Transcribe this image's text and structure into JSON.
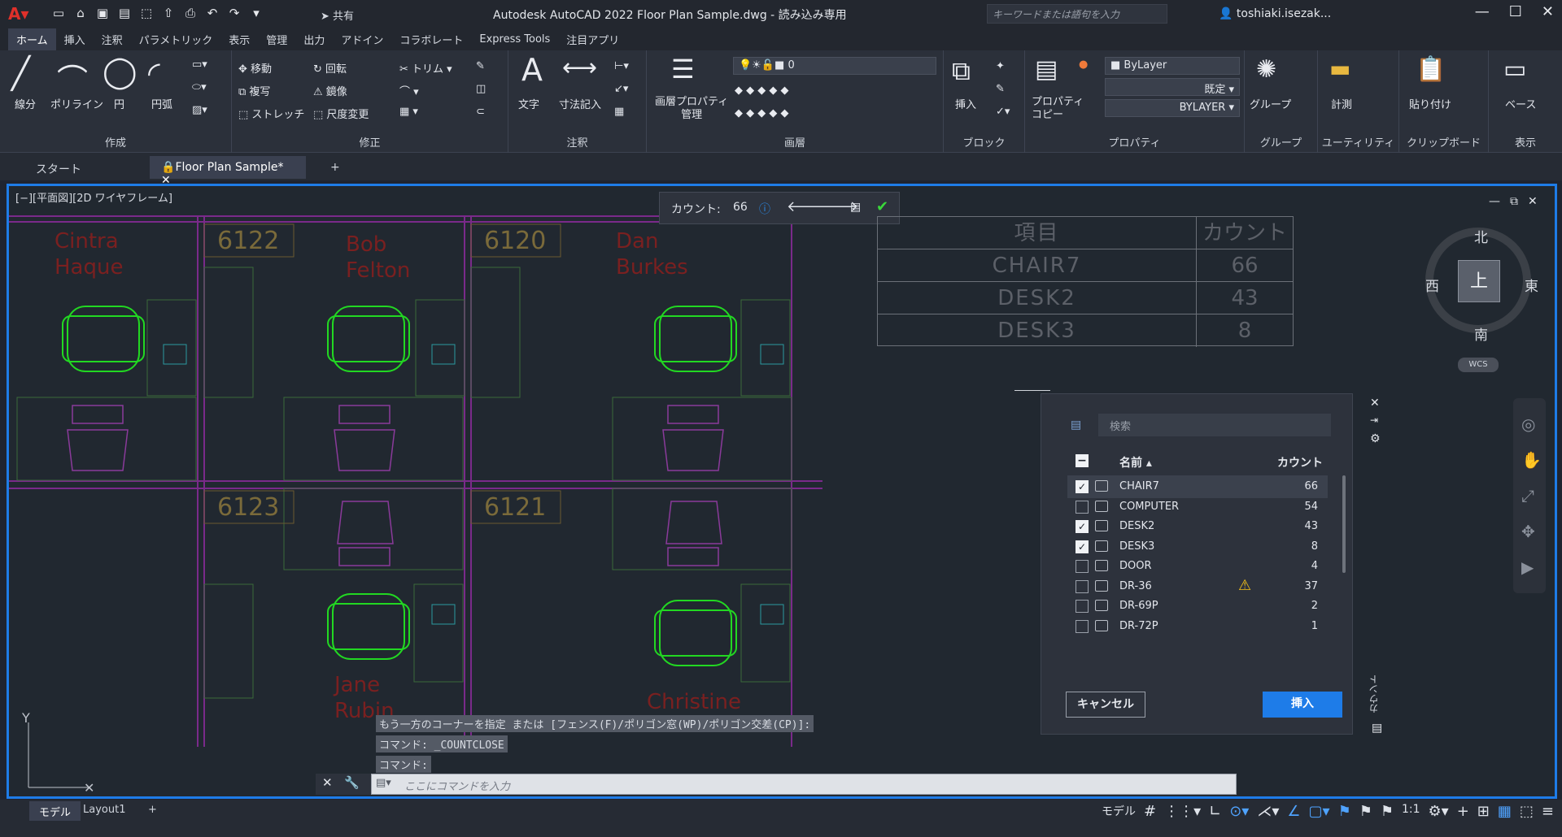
{
  "title": {
    "app_title": "Autodesk AutoCAD 2022   Floor Plan Sample.dwg - 読み込み専用",
    "share": "共有",
    "search_placeholder": "キーワードまたは語句を入力",
    "user": "toshiaki.isezak..."
  },
  "ribbon_tabs": [
    "ホーム",
    "挿入",
    "注釈",
    "パラメトリック",
    "表示",
    "管理",
    "出力",
    "アドイン",
    "コラボレート",
    "Express Tools",
    "注目アプリ"
  ],
  "ribbon": {
    "draw": {
      "label": "作成",
      "line": "線分",
      "polyline": "ポリライン",
      "circle": "円",
      "arc": "円弧"
    },
    "modify": {
      "label": "修正",
      "move": "移動",
      "copy": "複写",
      "stretch": "ストレッチ",
      "rotate": "回転",
      "mirror": "鏡像",
      "scale": "尺度変更",
      "trim": "トリム"
    },
    "annotation": {
      "label": "注釈",
      "text": "文字",
      "dimension": "寸法記入"
    },
    "layers": {
      "label": "画層",
      "layer_props": "画層プロパティ\n管理",
      "layer_value": "0"
    },
    "block": {
      "label": "ブロック",
      "insert": "挿入"
    },
    "properties": {
      "label": "プロパティ",
      "match": "プロパティ\nコピー",
      "color": "ByLayer",
      "linetype": "既定",
      "lineweight": "BYLAYER"
    },
    "groups": {
      "label": "グループ",
      "group": "グループ"
    },
    "utilities": {
      "label": "ユーティリティ",
      "measure": "計測"
    },
    "clipboard": {
      "label": "クリップボード",
      "paste": "貼り付け"
    },
    "view": {
      "label": "表示",
      "base": "ベース"
    }
  },
  "doc_tabs": {
    "start": "スタート",
    "file": "Floor Plan Sample*"
  },
  "viewport": {
    "label": "[−][平面図][2D ワイヤフレーム]"
  },
  "count_toolbar": {
    "label": "カウント:",
    "value": "66"
  },
  "drawing": {
    "rooms": [
      "6122",
      "6120",
      "6123",
      "6121"
    ],
    "names": [
      "Cintra\nHaque",
      "Bob\nFelton",
      "Dan\nBurkes",
      "Jane\nRubin",
      "Christine"
    ]
  },
  "table": {
    "headers": [
      "項目",
      "カウント"
    ],
    "rows": [
      [
        "CHAIR7",
        "66"
      ],
      [
        "DESK2",
        "43"
      ],
      [
        "DESK3",
        "8"
      ]
    ]
  },
  "viewcube": {
    "north": "北",
    "south": "南",
    "east": "東",
    "west": "西",
    "top": "上",
    "wcs": "WCS"
  },
  "palette": {
    "search_placeholder": "検索",
    "col_name": "名前",
    "col_count": "カウント",
    "side_label": "カウント",
    "items": [
      {
        "name": "CHAIR7",
        "count": "66",
        "checked": true,
        "warning": false
      },
      {
        "name": "COMPUTER",
        "count": "54",
        "checked": false,
        "warning": false
      },
      {
        "name": "DESK2",
        "count": "43",
        "checked": true,
        "warning": false
      },
      {
        "name": "DESK3",
        "count": "8",
        "checked": true,
        "warning": false
      },
      {
        "name": "DOOR",
        "count": "4",
        "checked": false,
        "warning": false
      },
      {
        "name": "DR-36",
        "count": "37",
        "checked": false,
        "warning": true
      },
      {
        "name": "DR-69P",
        "count": "2",
        "checked": false,
        "warning": false
      },
      {
        "name": "DR-72P",
        "count": "1",
        "checked": false,
        "warning": false
      }
    ],
    "cancel": "キャンセル",
    "insert": "挿入"
  },
  "command": {
    "history": [
      "もう一方のコーナーを指定 または [フェンス(F)/ポリゴン窓(WP)/ポリゴン交差(CP)]:",
      "コマンド: _COUNTCLOSE",
      "コマンド:"
    ],
    "placeholder": "ここにコマンドを入力"
  },
  "status": {
    "model": "モデル",
    "layout": "Layout1",
    "model_btn": "モデル",
    "scale": "1:1"
  }
}
